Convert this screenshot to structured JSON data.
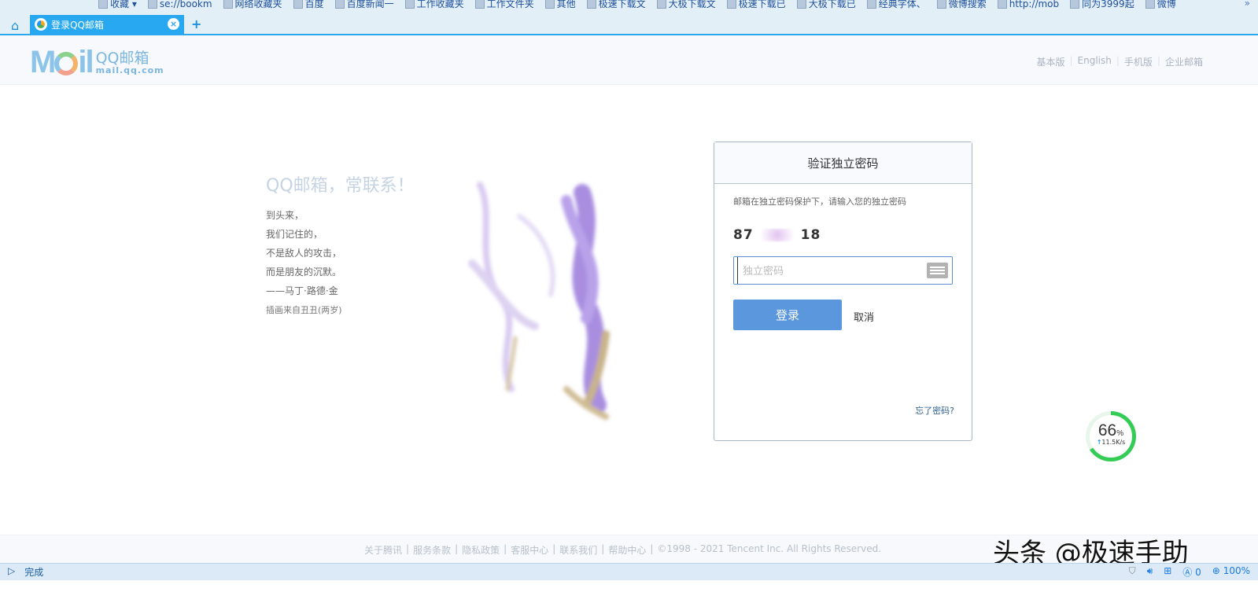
{
  "bookmarks": {
    "items": [
      "收藏 ▾",
      "se://bookm",
      "网络收藏夹",
      "百度",
      "百度新闻一",
      "工作收藏夹",
      "工作文件夹",
      "其他",
      "极速下载文",
      "大极下载文",
      "极速下载已",
      "大极下载已",
      "经典字体、",
      "微博搜索",
      "http://mob",
      "同为3999起",
      "微博"
    ],
    "more": "»"
  },
  "tabs": {
    "active_title": "登录QQ邮箱",
    "close": "×",
    "new_tab": "+",
    "home": "⌂"
  },
  "header": {
    "logo_main": "M",
    "logo_tail": "il",
    "logo_cn": "QQ邮箱",
    "logo_domain": "mail.qq.com",
    "links": [
      "基本版",
      "English",
      "手机版",
      "企业邮箱"
    ],
    "sep": "|"
  },
  "intro": {
    "slogan": "QQ邮箱，常联系！",
    "poem": [
      "到头来，",
      "我们记住的，",
      "不是敌人的攻击，",
      "而是朋友的沉默。",
      "——马丁·路德·金"
    ],
    "credit": "插画来自丑丑(两岁)"
  },
  "card": {
    "title": "验证独立密码",
    "hint": "邮箱在独立密码保护下，请输入您的独立密码",
    "account_prefix": "87",
    "account_suffix": "18",
    "password_placeholder": "独立密码",
    "password_value": "",
    "login": "登录",
    "cancel": "取消",
    "forgot": "忘了密码?"
  },
  "speed": {
    "percent": "66",
    "unit": "%",
    "rate": "11.5K/s",
    "fraction": 0.66
  },
  "footer": {
    "links": [
      "关于腾讯",
      "服务条款",
      "隐私政策",
      "客服中心",
      "联系我们",
      "帮助中心"
    ],
    "copyright": "©1998 - 2021 Tencent Inc. All Rights Reserved."
  },
  "watermark": "头条 @极速手助",
  "status": {
    "text": "完成",
    "ad_count": "0",
    "zoom": "100%"
  },
  "colors": {
    "accent": "#27a8f0",
    "button": "#5a97dd",
    "progress": "#33cc55"
  }
}
